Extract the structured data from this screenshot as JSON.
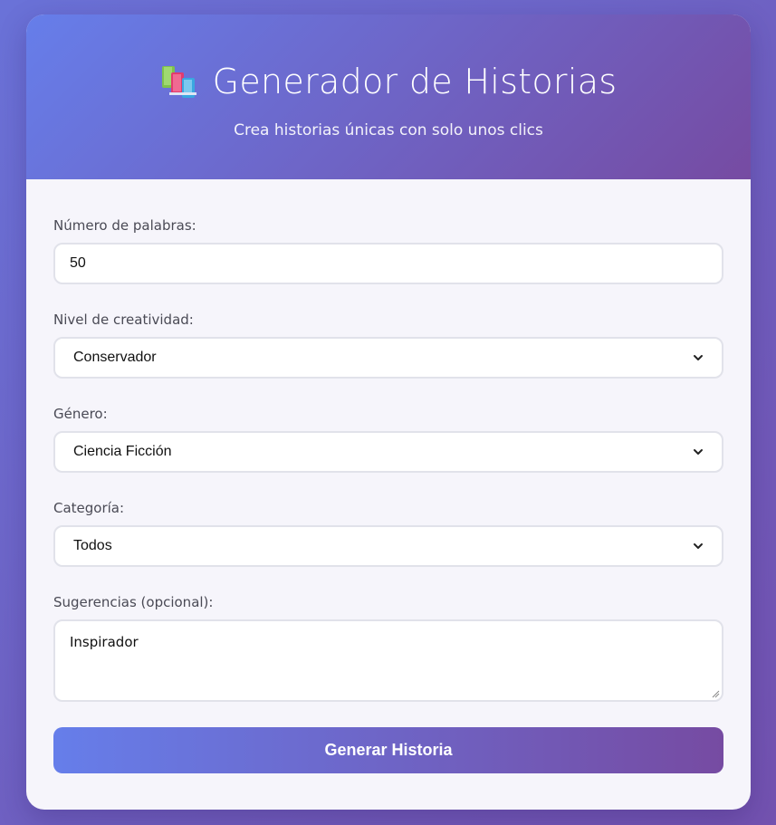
{
  "header": {
    "icon": "books-icon",
    "title": "Generador de Historias",
    "subtitle": "Crea historias únicas con solo unos clics"
  },
  "form": {
    "word_count": {
      "label": "Número de palabras:",
      "value": "50"
    },
    "creativity": {
      "label": "Nivel de creatividad:",
      "selected": "Conservador"
    },
    "genre": {
      "label": "Género:",
      "selected": "Ciencia Ficción"
    },
    "category": {
      "label": "Categoría:",
      "selected": "Todos"
    },
    "suggestions": {
      "label": "Sugerencias (opcional):",
      "value": "Inspirador"
    },
    "submit_label": "Generar Historia"
  },
  "colors": {
    "gradient_start": "#667eea",
    "gradient_end": "#764ba2",
    "card_background": "#f6f5fb"
  }
}
